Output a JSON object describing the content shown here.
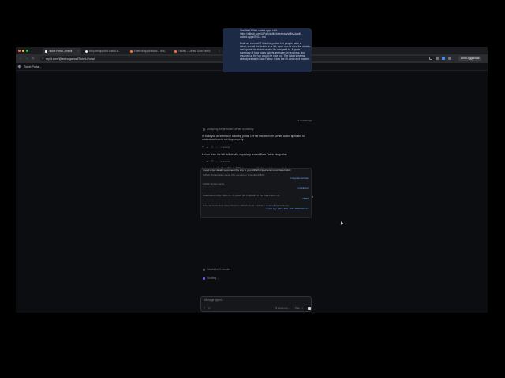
{
  "browser": {
    "tabs": [
      {
        "title": "Ticket Portal – Replit",
        "favicon_color": "#f5f5f5",
        "active": true
      },
      {
        "title": "kirby/ide/apps/int-coded-a...",
        "favicon_color": "#e8e8e8",
        "active": false
      },
      {
        "title": "External applications – Wat...",
        "favicon_color": "#f26b38",
        "active": false
      },
      {
        "title": "Tickets – UiPath Data Fabric",
        "favicon_color": "#f26b38",
        "active": false
      }
    ],
    "url": "replit.com/@arnivagarwal/Ticket-Portal",
    "profile_label": "Arnifi Aggarwali",
    "accent_colors": {
      "close": "#ff5f57",
      "minimize": "#febc2e",
      "maximize": "#28c840"
    }
  },
  "app": {
    "title": "Ticket Portal"
  },
  "chat": {
    "user_message": {
      "line1": "Use the UiPath coded apps skill:",
      "link1": "https://github.com/UiPath/skills/tree/main/skills/uipath-",
      "link2": "coded-apps/SKILL.md",
      "line4": "Build an internal IT ticketing portal. Let people raise a",
      "line5": "ticket, see all the tickets in a list, open one to view the details,",
      "line6": "and update its status or who it's assigned to. A quick",
      "line7": "summary of how many tickets are open, in progress, and",
      "line8": "resolved at the top would be nice too. The ticket schema",
      "line9": "already exists in Data Fabric. Keep the UI clean and modern.",
      "time": "16 minutes ago"
    },
    "status_analyzing": "Analyzing the provided UiPath repository",
    "msg1_line1": "I'll build you an internal IT ticketing portal. Let me first fetch the UiPath coded apps skill to",
    "msg1_line2": "understand how to set it up properly.",
    "actions1": "7 actions",
    "msg2": "Let me fetch the full skill details, especially around Data Fabric integration:",
    "actions2": "3 actions",
    "msg3": "Let me fetch the Data Fabric SDK docs and scaffolding details in parallel:",
    "actions3": "7 actions",
    "msg4": "Let me fetch a few more references: Now while I check login status and set up the CLI:",
    "actions4": "Readme",
    "msg5_line1": "Good — the UiPath CLI is available. Let me check its login status and install the coded-apps tool",
    "msg5_line2": "while I ask you for the connection details I need.",
    "actions5": "2 actions",
    "card": {
      "heading": "I need a few details to connect this app to your UiPath Cloud tenant and Data Fabric",
      "q1": "UiPath Organization name (the org slug in your cloud URL)",
      "a1": "Integrations/Auto",
      "q2": "UiPath Tenant name",
      "a2": "mobilicorn",
      "q3": "Data Fabric entity name for IT tickets (as it appears in the Data Fabric UI)",
      "a3": "Ticket",
      "q4": "External Application Client ID (from UiPath Cloud > Admin > External Applications)",
      "a4": "coded-app-a4b3-48f1-ab51c5f6b9f2b21c"
    },
    "status_waiting": "Waited for 3 minutes",
    "status_working": "Working...",
    "input_placeholder": "Message Agent...",
    "mode_label": "Economy",
    "plan_label": "Plan"
  }
}
